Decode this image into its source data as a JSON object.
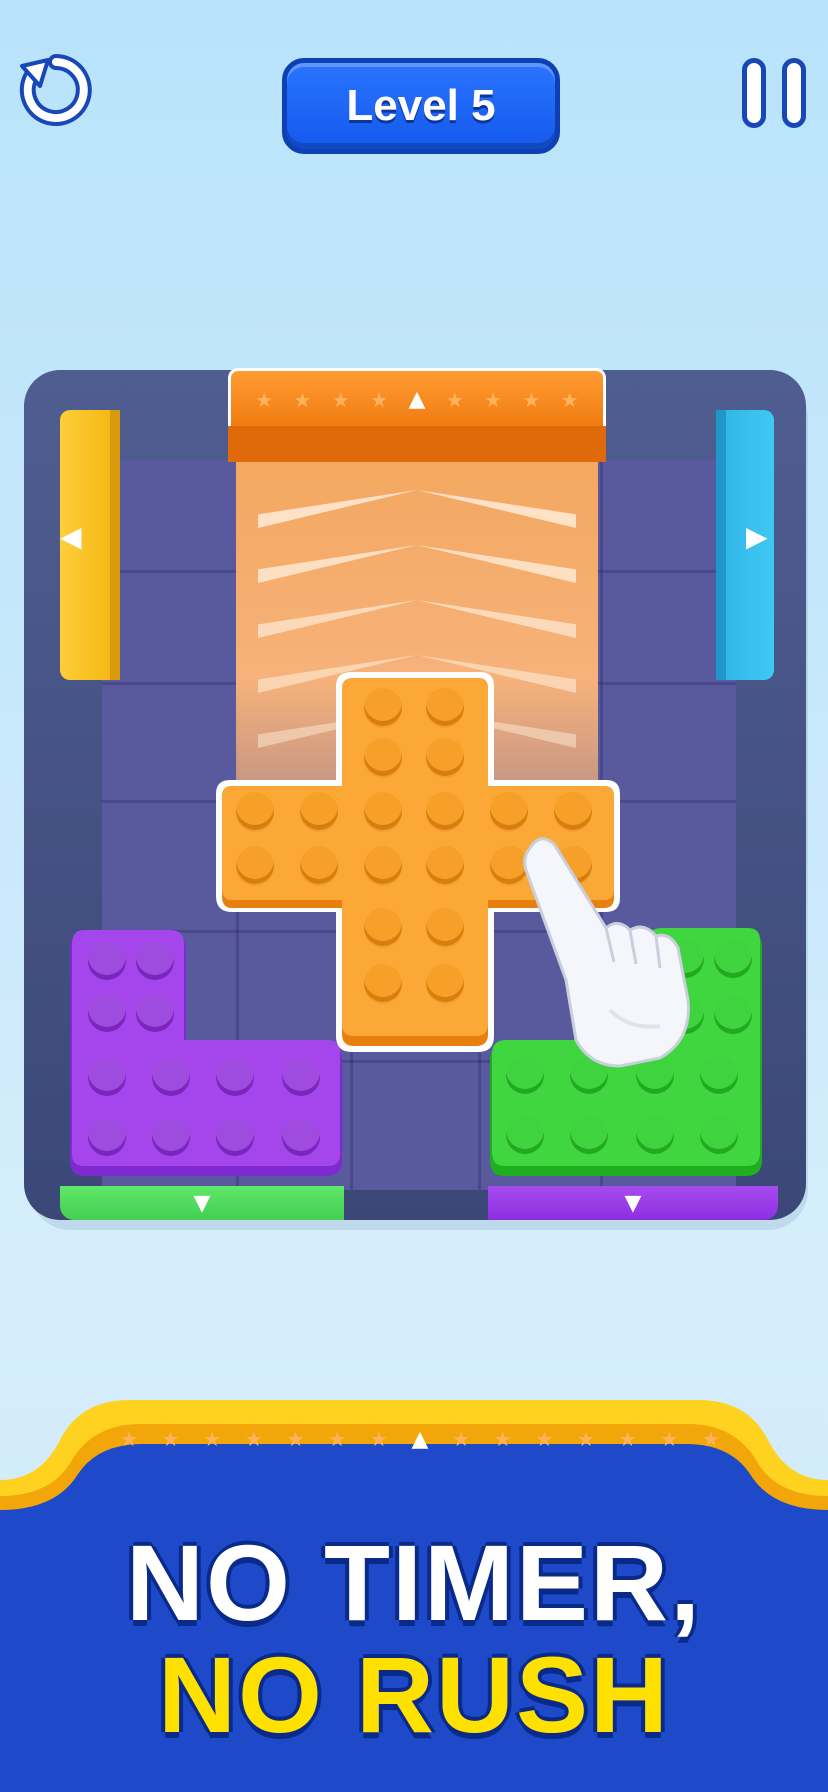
{
  "header": {
    "level_label": "Level 5",
    "restart_icon": "restart-icon",
    "pause_icon": "pause-icon"
  },
  "board": {
    "gates": [
      {
        "name": "top",
        "color": "#f07b10"
      },
      {
        "name": "left",
        "color": "#f3b40e"
      },
      {
        "name": "right",
        "color": "#2db4e6"
      },
      {
        "name": "bottom-left",
        "color": "#43cf52"
      },
      {
        "name": "bottom-right",
        "color": "#8d2fe0"
      }
    ],
    "blocks": [
      {
        "name": "orange-plus-block",
        "color": "#f29a24"
      },
      {
        "name": "purple-l-block",
        "color": "#9a3fe0"
      },
      {
        "name": "green-l-block",
        "color": "#35c935"
      }
    ],
    "hint": "pointing-hand-icon"
  },
  "banner": {
    "line1": "NO TIMER,",
    "line2": "NO RUSH",
    "line1_color": "#ffffff",
    "line2_color": "#ffe100",
    "background": "#1e49c8",
    "border": "#ffd21f"
  }
}
